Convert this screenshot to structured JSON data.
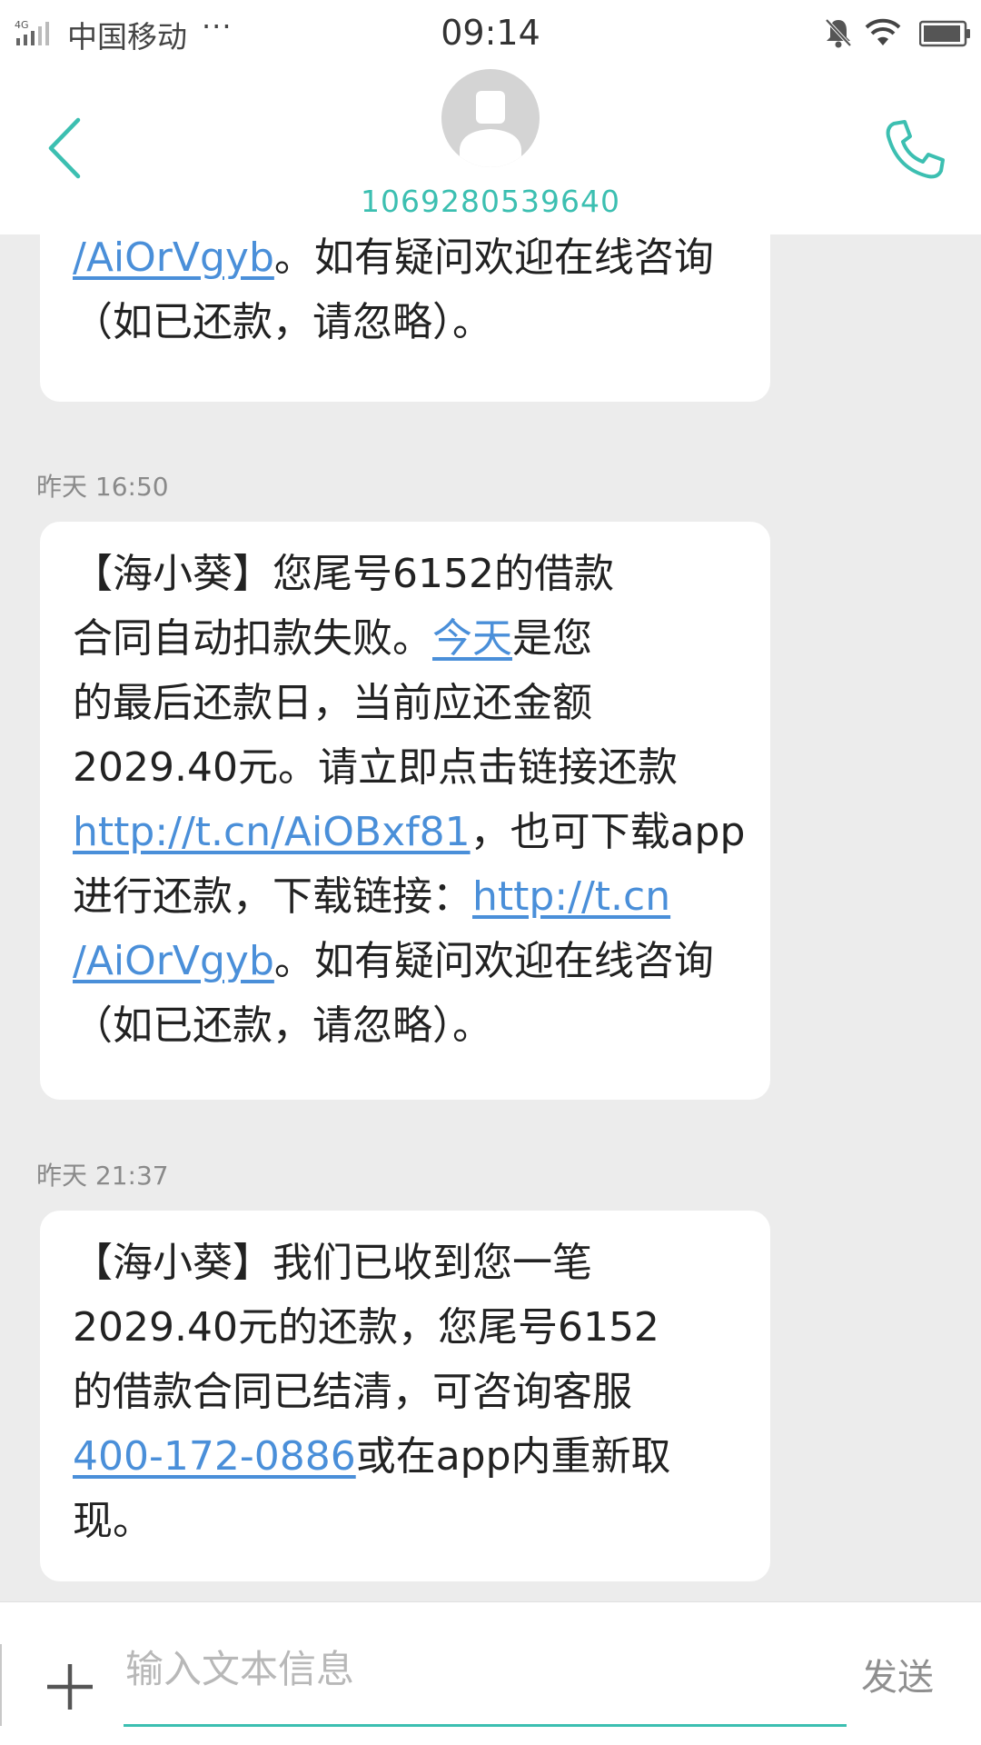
{
  "status_bar": {
    "network": "4G",
    "carrier": "中国移动",
    "more": "···",
    "time": "09:14"
  },
  "header": {
    "contact_number": "1069280539640"
  },
  "messages": [
    {
      "lines": [
        [
          {
            "t": "/AiOrVgyb",
            "link": true
          },
          {
            "t": "。如有疑问欢迎在线咨询"
          }
        ],
        [
          {
            "t": "（如已还款，请忽略）。"
          }
        ]
      ]
    },
    {
      "timestamp": "昨天  16:50",
      "lines": [
        [
          {
            "t": "【海小葵】您尾号6152的借款"
          }
        ],
        [
          {
            "t": "合同自动扣款失败。"
          },
          {
            "t": "今天",
            "link": true
          },
          {
            "t": "是您"
          }
        ],
        [
          {
            "t": "的最后还款日，当前应还金额"
          }
        ],
        [
          {
            "t": "2029.40元。请立即点击链接还款"
          }
        ],
        [
          {
            "t": "http://t.cn/AiOBxf81",
            "link": true
          },
          {
            "t": "，也可下载app"
          }
        ],
        [
          {
            "t": "进行还款，下载链接："
          },
          {
            "t": "http://t.cn",
            "link": true
          }
        ],
        [
          {
            "t": "/AiOrVgyb",
            "link": true
          },
          {
            "t": "。如有疑问欢迎在线咨询"
          }
        ],
        [
          {
            "t": "（如已还款，请忽略）。"
          }
        ]
      ]
    },
    {
      "timestamp": "昨天  21:37",
      "lines": [
        [
          {
            "t": "【海小葵】我们已收到您一笔"
          }
        ],
        [
          {
            "t": "2029.40元的还款，您尾号6152"
          }
        ],
        [
          {
            "t": "的借款合同已结清，可咨询客服"
          }
        ],
        [
          {
            "t": "400-172-0886",
            "link": true
          },
          {
            "t": "或在app内重新取"
          }
        ],
        [
          {
            "t": "现。"
          }
        ]
      ]
    }
  ],
  "composer": {
    "placeholder": "输入文本信息",
    "send_label": "发送"
  },
  "colors": {
    "accent": "#3cbfb1",
    "link": "#4a8fd9",
    "background": "#ececec",
    "bubble": "#ffffff"
  },
  "icons": {
    "back": "chevron-left-icon",
    "call": "phone-icon",
    "avatar": "person-avatar-icon",
    "attach": "plus-icon"
  }
}
